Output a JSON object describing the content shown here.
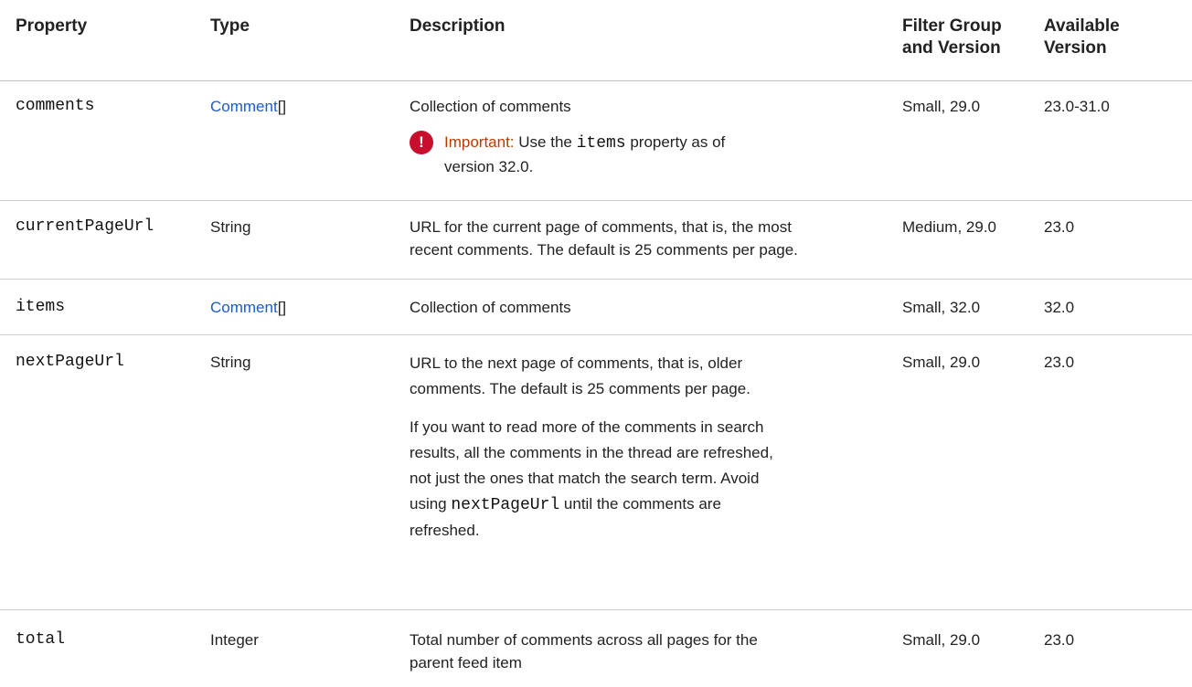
{
  "table": {
    "headers": {
      "property": "Property",
      "type": "Type",
      "description": "Description",
      "filter_line1": "Filter Group",
      "filter_line2": "and Version",
      "available_line1": "Available",
      "available_line2": "Version"
    },
    "rows": [
      {
        "property": "comments",
        "type_link": "Comment",
        "type_suffix": "[]",
        "description": "Collection of comments",
        "note": {
          "icon": "important-icon",
          "label": "Important:",
          "text_before": " Use the ",
          "code": "items",
          "text_after1": " property as of",
          "text_after2": "version 32.0."
        },
        "filter": "Small, 29.0",
        "available": "23.0-31.0"
      },
      {
        "property": "currentPageUrl",
        "type": "String",
        "description_line1": "URL for the current page of comments, that is, the most",
        "description_line2": "recent comments. The default is 25 comments per page.",
        "filter": "Medium, 29.0",
        "available": "23.0"
      },
      {
        "property": "items",
        "type_link": "Comment",
        "type_suffix": "[]",
        "description": "Collection of comments",
        "filter": "Small, 32.0",
        "available": "32.0"
      },
      {
        "property": "nextPageUrl",
        "type": "String",
        "description_line1": "URL to the next page of comments, that is, older",
        "description_line2": "comments. The default is 25 comments per page.",
        "para2_line1": "If you want to read more of the comments in search",
        "para2_line2": "results, all the comments in the thread are refreshed,",
        "para2_line3": "not just the ones that match the search term. Avoid",
        "para2_line4_before": "using ",
        "para2_line4_code": "nextPageUrl",
        "para2_line4_after": " until the comments are",
        "para2_line5": "refreshed.",
        "filter": "Small, 29.0",
        "available": "23.0"
      },
      {
        "property": "total",
        "type": "Integer",
        "description_line1": "Total number of comments across all pages for the",
        "description_line2": "parent feed item",
        "filter": "Small, 29.0",
        "available": "23.0"
      }
    ]
  },
  "colors": {
    "link": "#1b5bd6",
    "important_label": "#c23700",
    "important_icon": "#c8102e"
  }
}
